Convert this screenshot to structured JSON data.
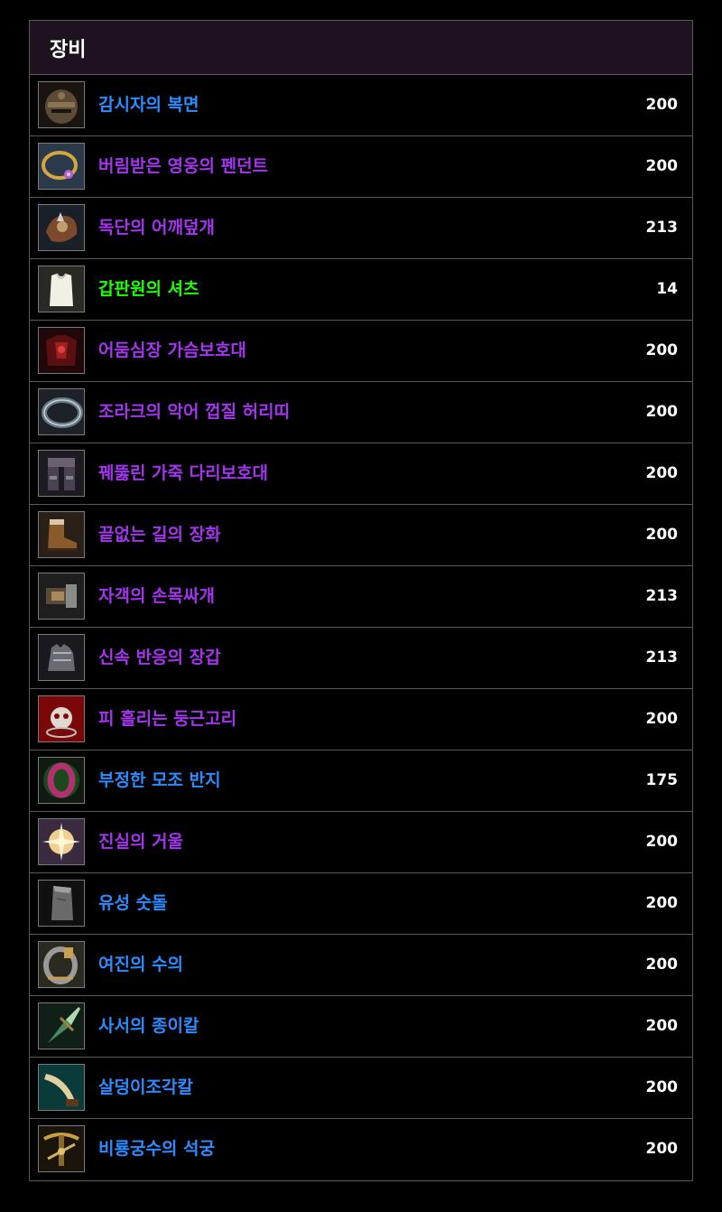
{
  "colors": {
    "epic": "#a335ee",
    "rare": "#2c8cff",
    "uncommon": "#1eff00",
    "header_bg": "#1f1220",
    "border": "#5a5a5a"
  },
  "panel": {
    "title": "장비"
  },
  "items": [
    {
      "name": "감시자의 복면",
      "level": "200",
      "quality": "rare",
      "icon": "helmet-icon"
    },
    {
      "name": "버림받은 영웅의 펜던트",
      "level": "200",
      "quality": "epic",
      "icon": "pendant-icon"
    },
    {
      "name": "독단의 어깨덮개",
      "level": "213",
      "quality": "epic",
      "icon": "shoulder-icon"
    },
    {
      "name": "갑판원의 셔츠",
      "level": "14",
      "quality": "uncommon",
      "icon": "shirt-icon"
    },
    {
      "name": "어둠심장 가슴보호대",
      "level": "200",
      "quality": "epic",
      "icon": "chest-armor-icon"
    },
    {
      "name": "조라크의 악어 껍질 허리띠",
      "level": "200",
      "quality": "epic",
      "icon": "belt-icon"
    },
    {
      "name": "꿰뚫린 가죽 다리보호대",
      "level": "200",
      "quality": "epic",
      "icon": "leg-armor-icon"
    },
    {
      "name": "끝없는 길의 장화",
      "level": "200",
      "quality": "epic",
      "icon": "boots-icon"
    },
    {
      "name": "자객의 손목싸개",
      "level": "213",
      "quality": "epic",
      "icon": "bracer-icon"
    },
    {
      "name": "신속 반응의 장갑",
      "level": "213",
      "quality": "epic",
      "icon": "gloves-icon"
    },
    {
      "name": "피 흘리는 둥근고리",
      "level": "200",
      "quality": "epic",
      "icon": "skull-ring-icon"
    },
    {
      "name": "부정한 모조 반지",
      "level": "175",
      "quality": "rare",
      "icon": "ring-icon"
    },
    {
      "name": "진실의 거울",
      "level": "200",
      "quality": "epic",
      "icon": "star-mirror-icon"
    },
    {
      "name": "유성 숫돌",
      "level": "200",
      "quality": "rare",
      "icon": "whetstone-icon"
    },
    {
      "name": "여진의 수의",
      "level": "200",
      "quality": "rare",
      "icon": "shroud-icon"
    },
    {
      "name": "사서의 종이칼",
      "level": "200",
      "quality": "rare",
      "icon": "paper-knife-icon"
    },
    {
      "name": "살덩이조각칼",
      "level": "200",
      "quality": "rare",
      "icon": "flesh-carver-icon"
    },
    {
      "name": "비룡궁수의 석궁",
      "level": "200",
      "quality": "rare",
      "icon": "crossbow-icon"
    }
  ]
}
